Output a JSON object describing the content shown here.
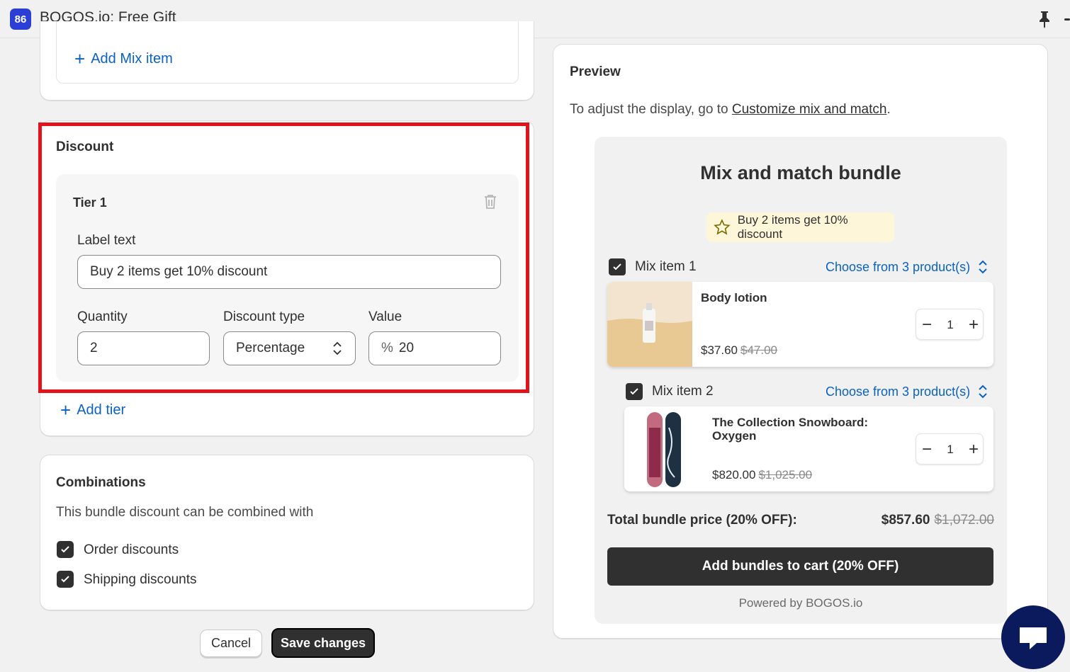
{
  "app": {
    "logo_text": "86",
    "title": "BOGOS.io: Free Gift"
  },
  "mix_section": {
    "add_mix_item_label": "Add Mix item"
  },
  "discount": {
    "title": "Discount",
    "tier": {
      "title": "Tier 1",
      "label_text_label": "Label text",
      "label_text_value": "Buy 2 items get 10% discount",
      "quantity_label": "Quantity",
      "quantity_value": "2",
      "discount_type_label": "Discount type",
      "discount_type_value": "Percentage",
      "value_label": "Value",
      "value_prefix": "%",
      "value_value": "20"
    },
    "add_tier_label": "Add tier"
  },
  "combinations": {
    "title": "Combinations",
    "description": "This bundle discount can be combined with",
    "options": [
      {
        "label": "Order discounts",
        "checked": true
      },
      {
        "label": "Shipping discounts",
        "checked": true
      }
    ]
  },
  "actions": {
    "cancel_label": "Cancel",
    "save_label": "Save changes"
  },
  "preview": {
    "title": "Preview",
    "desc_prefix": "To adjust the display, go to ",
    "desc_link": "Customize mix and match",
    "desc_suffix": ".",
    "bundle": {
      "title": "Mix and match bundle",
      "promo_text": "Buy 2 items get 10% discount",
      "items": [
        {
          "label": "Mix item 1",
          "choose_label": "Choose from 3 product(s)",
          "product_name": "Body lotion",
          "price": "$37.60",
          "old_price": "$47.00",
          "qty": "1"
        },
        {
          "label": "Mix item 2",
          "choose_label": "Choose from 3 product(s)",
          "product_name": "The Collection Snowboard: Oxygen",
          "price": "$820.00",
          "old_price": "$1,025.00",
          "qty": "1"
        }
      ],
      "total_label": "Total bundle price (20% OFF):",
      "total_price": "$857.60",
      "total_old_price": "$1,072.00",
      "add_to_cart_label": "Add bundles to cart (20% OFF)",
      "powered_by": "Powered by BOGOS.io"
    }
  },
  "colors": {
    "accent_link": "#0a62c5",
    "highlight_border": "#e2141b",
    "dark_button": "#303030",
    "chat_bubble": "#0a1a5c"
  }
}
